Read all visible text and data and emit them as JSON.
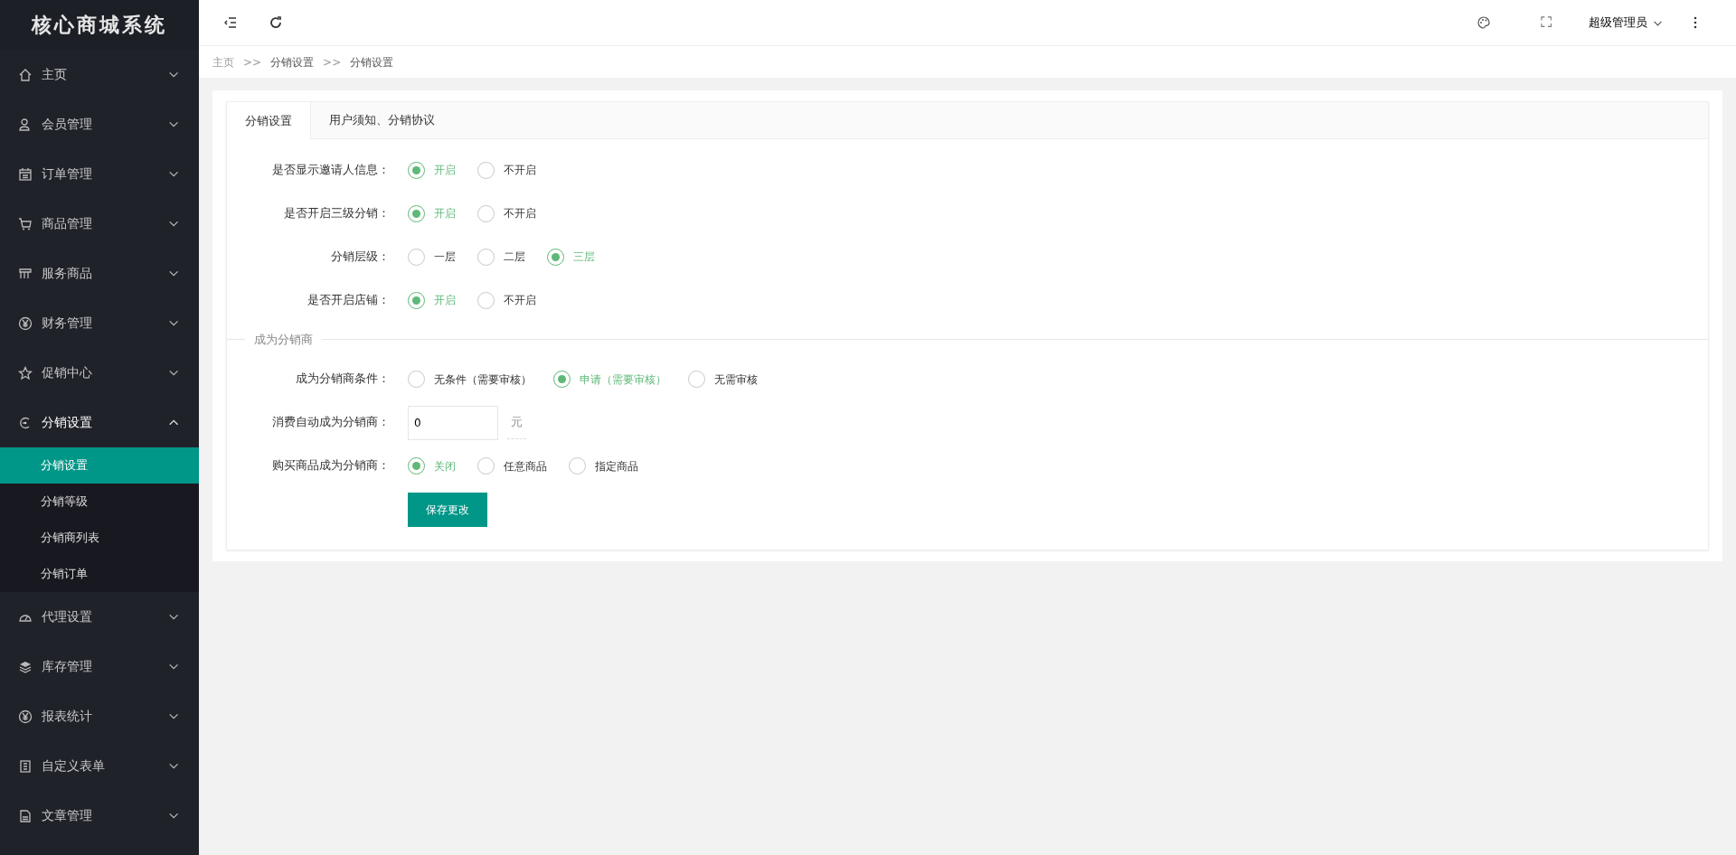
{
  "sidebar": {
    "logo": "核心商城系统",
    "items": [
      {
        "label": "主页",
        "expanded": false
      },
      {
        "label": "会员管理",
        "expanded": false
      },
      {
        "label": "订单管理",
        "expanded": false
      },
      {
        "label": "商品管理",
        "expanded": false
      },
      {
        "label": "服务商品",
        "expanded": false
      },
      {
        "label": "财务管理",
        "expanded": false
      },
      {
        "label": "促销中心",
        "expanded": false
      },
      {
        "label": "分销设置",
        "expanded": true,
        "children": [
          {
            "label": "分销设置",
            "selected": true
          },
          {
            "label": "分销等级",
            "selected": false
          },
          {
            "label": "分销商列表",
            "selected": false
          },
          {
            "label": "分销订单",
            "selected": false
          }
        ]
      },
      {
        "label": "代理设置",
        "expanded": false
      },
      {
        "label": "库存管理",
        "expanded": false
      },
      {
        "label": "报表统计",
        "expanded": false
      },
      {
        "label": "自定义表单",
        "expanded": false
      },
      {
        "label": "文章管理",
        "expanded": false
      }
    ]
  },
  "header": {
    "user": "超级管理员"
  },
  "breadcrumb": [
    {
      "kind": "link",
      "label": "主页"
    },
    {
      "kind": "separator",
      "label": ">>"
    },
    {
      "kind": "link",
      "label": "分销设置"
    },
    {
      "kind": "separator",
      "label": ">>"
    },
    {
      "kind": "current",
      "label": "分销设置"
    }
  ],
  "tabs": [
    {
      "label": "分销设置",
      "selected": true
    },
    {
      "label": "用户须知、分销协议",
      "selected": false
    }
  ],
  "form": [
    {
      "kind": "radio",
      "label": "是否显示邀请人信息：",
      "options": [
        {
          "label": "开启",
          "selected": true
        },
        {
          "label": "不开启",
          "selected": false
        }
      ]
    },
    {
      "kind": "radio",
      "label": "是否开启三级分销：",
      "options": [
        {
          "label": "开启",
          "selected": true
        },
        {
          "label": "不开启",
          "selected": false
        }
      ]
    },
    {
      "kind": "radio",
      "label": "分销层级：",
      "options": [
        {
          "label": "一层",
          "selected": false
        },
        {
          "label": "二层",
          "selected": false
        },
        {
          "label": "三层",
          "selected": true
        }
      ]
    },
    {
      "kind": "radio",
      "label": "是否开启店铺：",
      "options": [
        {
          "label": "开启",
          "selected": true
        },
        {
          "label": "不开启",
          "selected": false
        }
      ]
    },
    {
      "kind": "legend",
      "label": "成为分销商"
    },
    {
      "kind": "radio",
      "label": "成为分销商条件：",
      "options": [
        {
          "label": "无条件（需要审核）",
          "selected": false
        },
        {
          "label": "申请（需要审核）",
          "selected": true
        },
        {
          "label": "无需审核",
          "selected": false
        }
      ]
    },
    {
      "kind": "input",
      "label": "消费自动成为分销商：",
      "value": "0",
      "suffix": "元"
    },
    {
      "kind": "radio",
      "label": "购买商品成为分销商：",
      "options": [
        {
          "label": "关闭",
          "selected": true
        },
        {
          "label": "任意商品",
          "selected": false
        },
        {
          "label": "指定商品",
          "selected": false
        }
      ]
    },
    {
      "kind": "button",
      "label": "保存更改"
    }
  ]
}
